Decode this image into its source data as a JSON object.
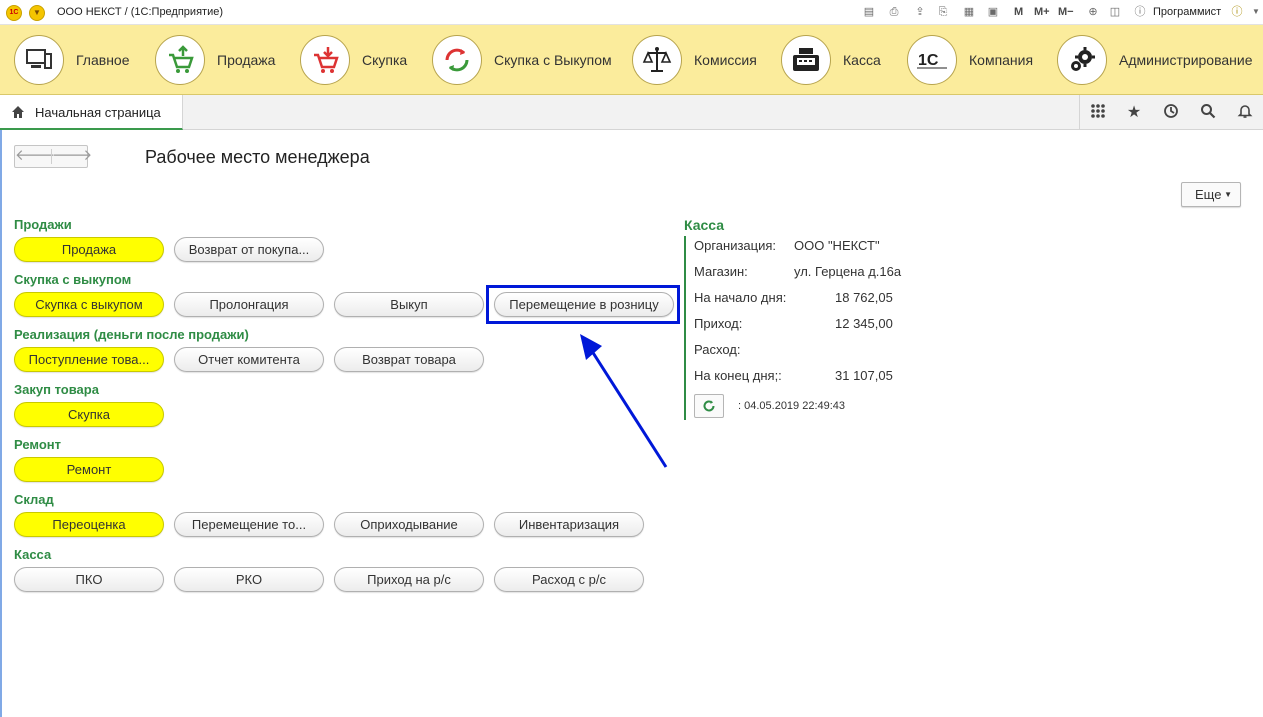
{
  "titlebar": {
    "title": "ООО НЕКСТ /   (1С:Предприятие)",
    "logo_text": "1С",
    "tools": [
      "save-icon",
      "print-icon",
      "export-icon",
      "print-preview-icon",
      "calculator-icon",
      "calendar-icon"
    ],
    "m_labels": [
      "M",
      "M+",
      "M−"
    ],
    "user": "Программист"
  },
  "sections": [
    {
      "label": "Главное",
      "icon": "computer-icon"
    },
    {
      "label": "Продажа",
      "icon": "cart-up-icon"
    },
    {
      "label": "Скупка",
      "icon": "cart-down-icon"
    },
    {
      "label": "Скупка с Выкупом",
      "icon": "cycle-arrows-icon"
    },
    {
      "label": "Комиссия",
      "icon": "scales-icon"
    },
    {
      "label": "Касса",
      "icon": "cash-register-icon"
    },
    {
      "label": "Компания",
      "icon": "1c-logo-icon"
    },
    {
      "label": "Администрирование",
      "icon": "gears-icon"
    }
  ],
  "tabs": {
    "home": "Начальная страница"
  },
  "page": {
    "title": "Рабочее место менеджера",
    "more": "Еще"
  },
  "groups": [
    {
      "title": "Продажи",
      "buttons": [
        "Продажа",
        "Возврат от покупа..."
      ]
    },
    {
      "title": "Скупка с выкупом",
      "buttons": [
        "Скупка с выкупом",
        "Пролонгация",
        "Выкуп",
        "Перемещение в розницу"
      ]
    },
    {
      "title": "Реализация (деньги после продажи)",
      "buttons": [
        "Поступление това...",
        "Отчет комитента",
        "Возврат товара"
      ]
    },
    {
      "title": "Закуп товара",
      "buttons": [
        "Скупка"
      ]
    },
    {
      "title": "Ремонт",
      "buttons": [
        "Ремонт"
      ]
    },
    {
      "title": "Склад",
      "buttons": [
        "Переоценка",
        "Перемещение то...",
        "Оприходывание",
        "Инвентаризация"
      ]
    },
    {
      "title": "Касса",
      "buttons": [
        "ПКО",
        "РКО",
        "Приход на р/с",
        "Расход с р/с"
      ]
    }
  ],
  "kassa": {
    "title": "Касса",
    "org_label": "Организация:",
    "org_value": "ООО \"НЕКСТ\"",
    "shop_label": "Магазин:",
    "shop_value": "ул. Герцена д.16а",
    "start_label": "На начало дня:",
    "start_value": "18 762,05",
    "income_label": "Приход:",
    "income_value": "12 345,00",
    "expense_label": "Расход:",
    "end_label": "На конец дня;:",
    "end_value": "31 107,05",
    "stamp": ":  04.05.2019 22:49:43"
  },
  "colors": {
    "accent_green": "#2f8c45",
    "highlight_yellow": "#ffff00",
    "section_bg": "#fbec9c",
    "annotation_blue": "#0018d8"
  }
}
